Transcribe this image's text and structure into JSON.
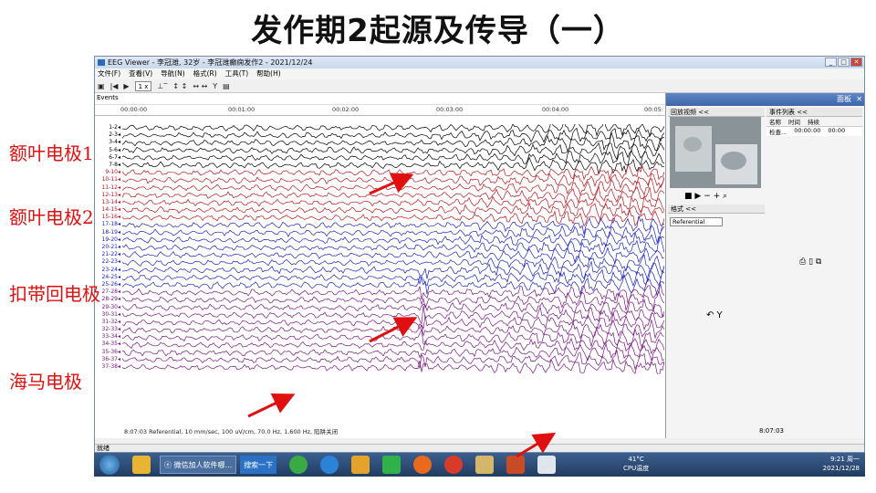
{
  "slide_title": "发作期2起源及传导（一）",
  "window": {
    "title": "EEG Viewer - 李冠潍, 32岁 - 李冠潍癫痫发作2 - 2021/12/24",
    "buttons": [
      "_",
      "□",
      "✕"
    ]
  },
  "menu": [
    "文件(F)",
    "查看(V)",
    "导航(N)",
    "格式(R)",
    "工具(T)",
    "帮助(H)"
  ],
  "toolbar": {
    "speed": "1 x"
  },
  "events_label": "Events",
  "time_ticks": [
    "00:00:00",
    "00:01:00",
    "00:02:00",
    "00:03:00",
    "00:04:00",
    "00:05:"
  ],
  "channels": [
    "1-2",
    "2-3",
    "3-4",
    "5-6",
    "6-7",
    "7-8",
    "9-10",
    "10-11",
    "11-12",
    "12-13",
    "13-14",
    "14-15",
    "15-16",
    "17-18",
    "18-19",
    "19-20",
    "20-21",
    "21-22",
    "22-23",
    "23-24",
    "24-25",
    "25-26",
    "27-28",
    "28-29",
    "29-30",
    "30-31",
    "31-32",
    "32-33",
    "33-34",
    "34-35",
    "35-36",
    "36-37",
    "37-38"
  ],
  "channel_groups": [
    {
      "label": "额叶电极1",
      "color": "#000000",
      "count": 6
    },
    {
      "label": "额叶电极2",
      "color": "#c0141c",
      "count": 7
    },
    {
      "label": "扣带回电极",
      "color": "#1a22c8",
      "count": 9
    },
    {
      "label": "海马电极",
      "color": "#7a1685",
      "count": 11
    }
  ],
  "eeg_footer": "8:07:03 Referential, 10 mm/sec, 100 uV/cm, 70.0 Hz, 1.600 Hz, 陷阱关闭",
  "panel": {
    "title": "面板",
    "video_header": "回放视频 <<",
    "format_header": "格式 <<",
    "format_value": "Referential",
    "events_header": "事件列表 <<",
    "events_columns": [
      "名称",
      "时间",
      "持续"
    ],
    "events_rows": [
      [
        "检查...",
        "00:00:00",
        "00:00"
      ]
    ],
    "time_display": "8:07:03"
  },
  "status_text": "就绪",
  "taskbar": {
    "items": [
      "微信加人软件哪...",
      "搜索一下"
    ],
    "cpu_temp": "41°C",
    "cpu_label": "CPU温度",
    "clock_time": "9:21 周一",
    "clock_date": "2021/12/28"
  },
  "accent_colors": {
    "annotation": "#e01010",
    "panel_head": "#4a72b4"
  }
}
